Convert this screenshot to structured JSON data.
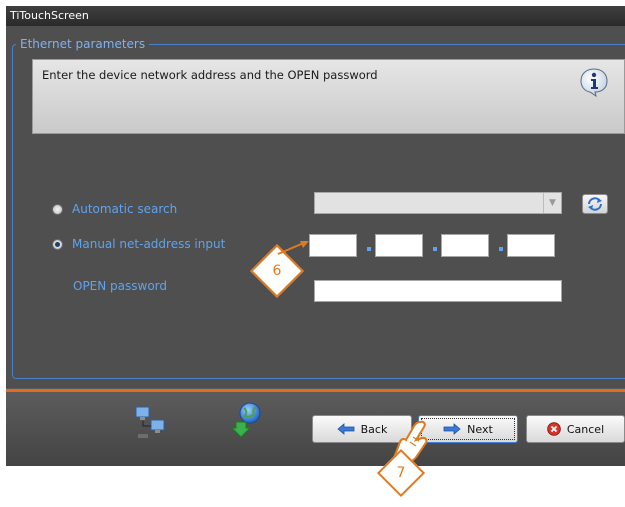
{
  "window": {
    "title": "TiTouchScreen"
  },
  "group": {
    "title": "Ethernet parameters"
  },
  "instruction": {
    "text": "Enter the device network address and the OPEN password"
  },
  "options": {
    "automatic_search_label": "Automatic search",
    "manual_input_label": "Manual net-address input",
    "selected": "manual"
  },
  "fields": {
    "open_password_label": "OPEN password",
    "combo_value": "",
    "ip_octets": [
      "",
      "",
      "",
      ""
    ],
    "password_value": ""
  },
  "footer": {
    "back_label": "Back",
    "next_label": "Next",
    "cancel_label": "Cancel"
  },
  "callouts": {
    "step_6": "6",
    "step_7": "7"
  },
  "colors": {
    "accent_blue": "#5fa3ee",
    "orange": "#e66a1e"
  }
}
